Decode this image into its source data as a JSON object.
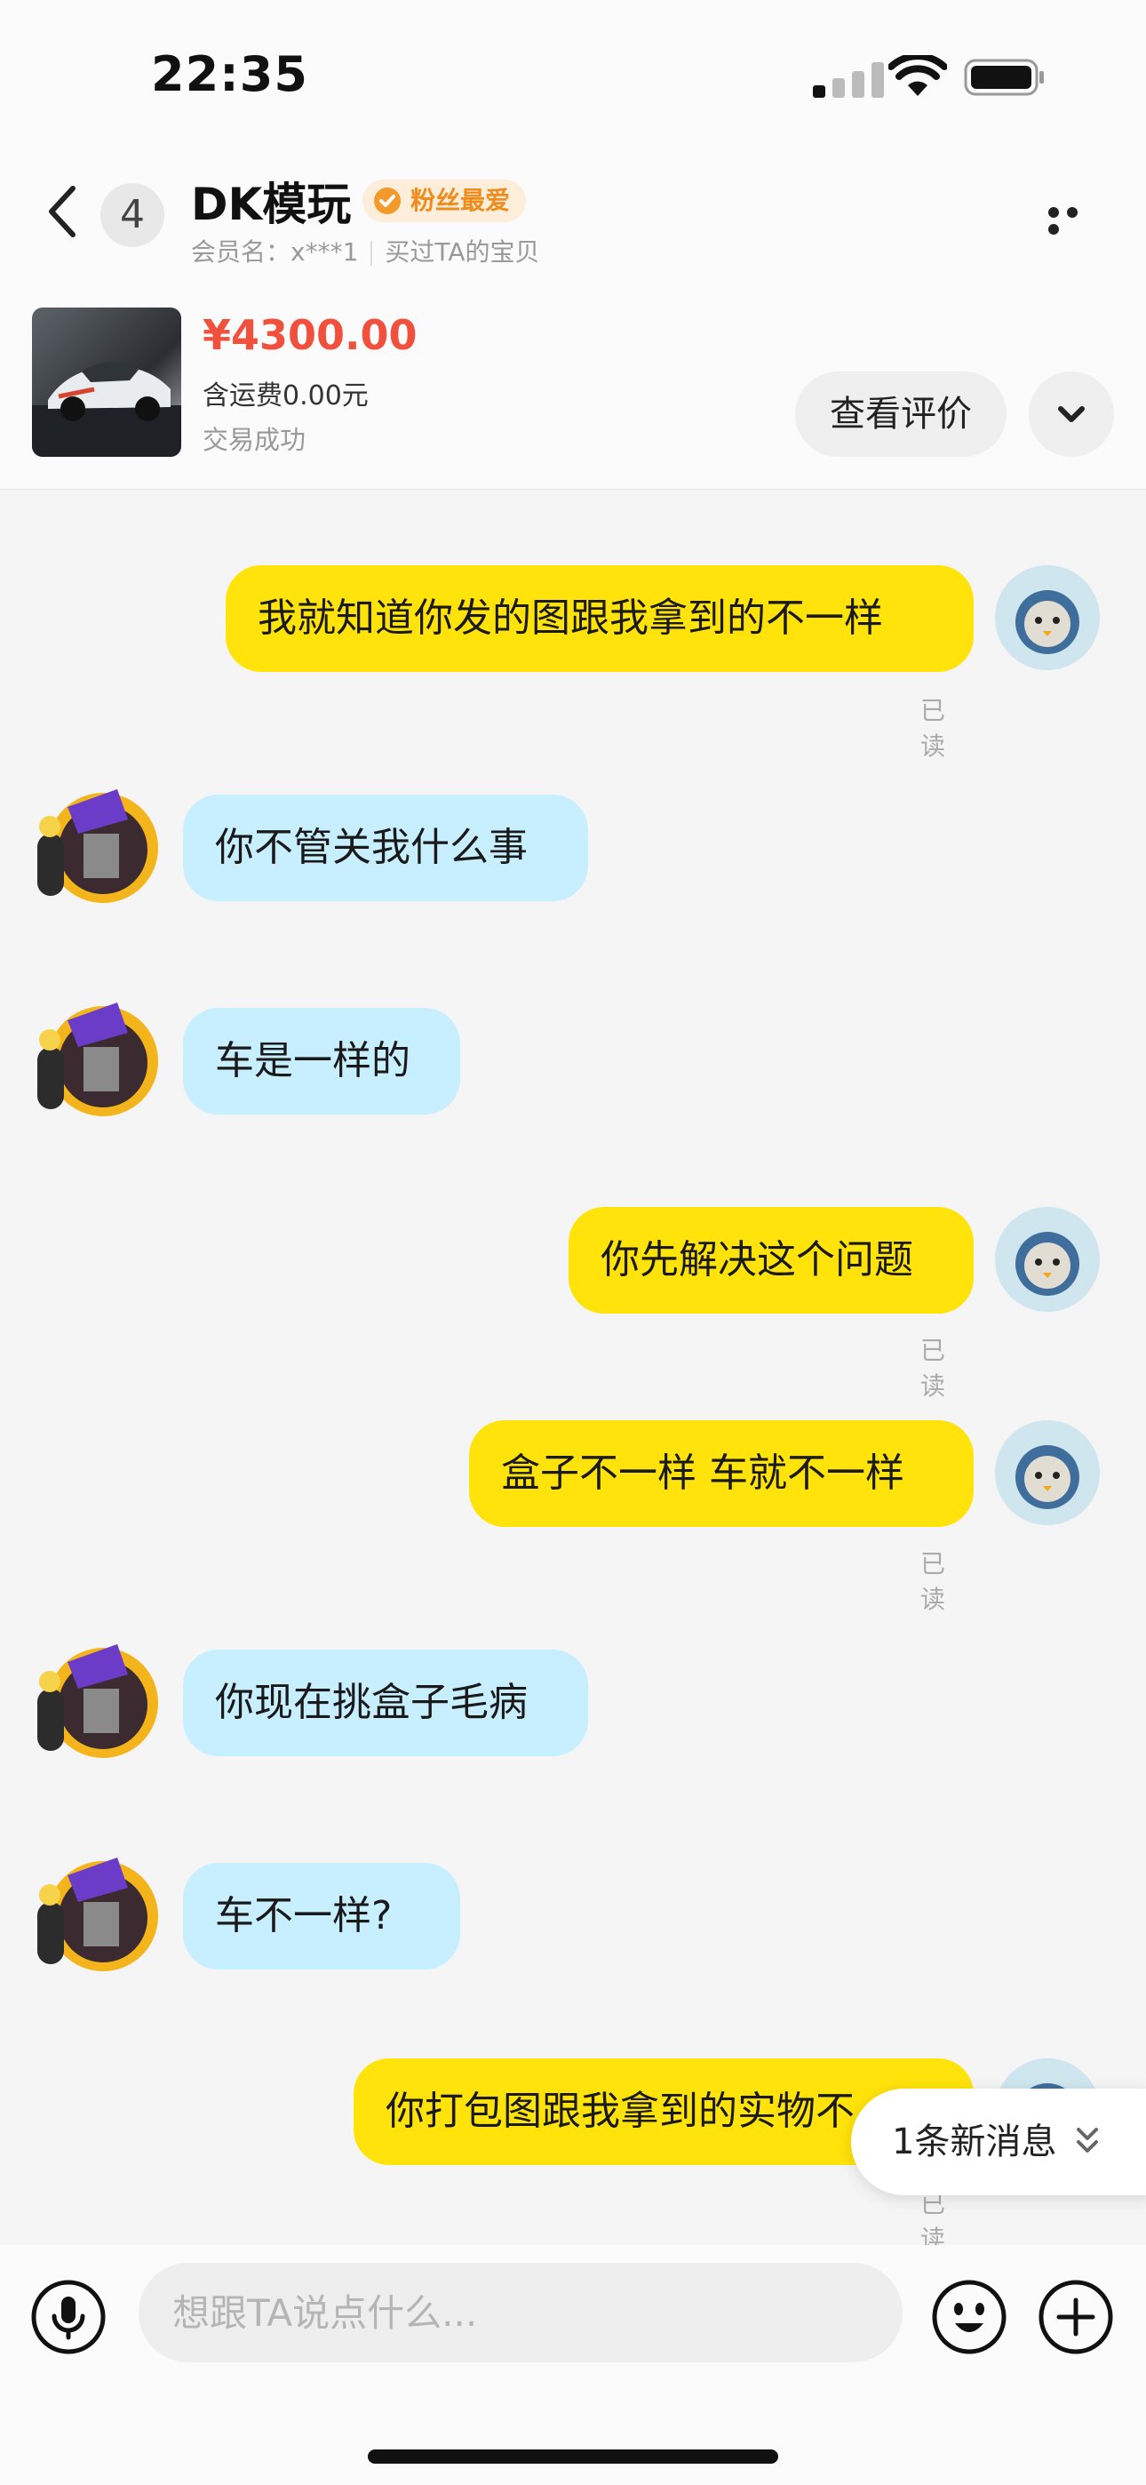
{
  "status_bar": {
    "time": "22:35"
  },
  "header": {
    "back_count": "4",
    "shop_name": "DK模玩",
    "badge": "粉丝最爱",
    "member_label": "会员名：x***1",
    "member_note": "买过TA的宝贝",
    "product": {
      "price": "¥4300.00",
      "shipping": "含运费0.00元",
      "status": "交易成功"
    },
    "review_button": "查看评价"
  },
  "messages": [
    {
      "from": "me",
      "text": "我就知道你发的图跟我拿到的不一样",
      "status": "已读"
    },
    {
      "from": "them",
      "text": "你不管关我什么事"
    },
    {
      "from": "them",
      "text": "车是一样的"
    },
    {
      "from": "me",
      "text": "你先解决这个问题",
      "status": "已读"
    },
    {
      "from": "me",
      "text": "盒子不一样 车就不一样",
      "status": "已读"
    },
    {
      "from": "them",
      "text": "你现在挑盒子毛病"
    },
    {
      "from": "them",
      "text": "车不一样?"
    },
    {
      "from": "me",
      "text": "你打包图跟我拿到的实物不",
      "status": "已读"
    }
  ],
  "new_message_pill": "1条新消息",
  "input": {
    "placeholder": "想跟TA说点什么..."
  },
  "colors": {
    "my_bubble": "#ffe30a",
    "their_bubble": "#c8efff",
    "price": "#f0503c",
    "badge_text": "#f08c1c"
  }
}
